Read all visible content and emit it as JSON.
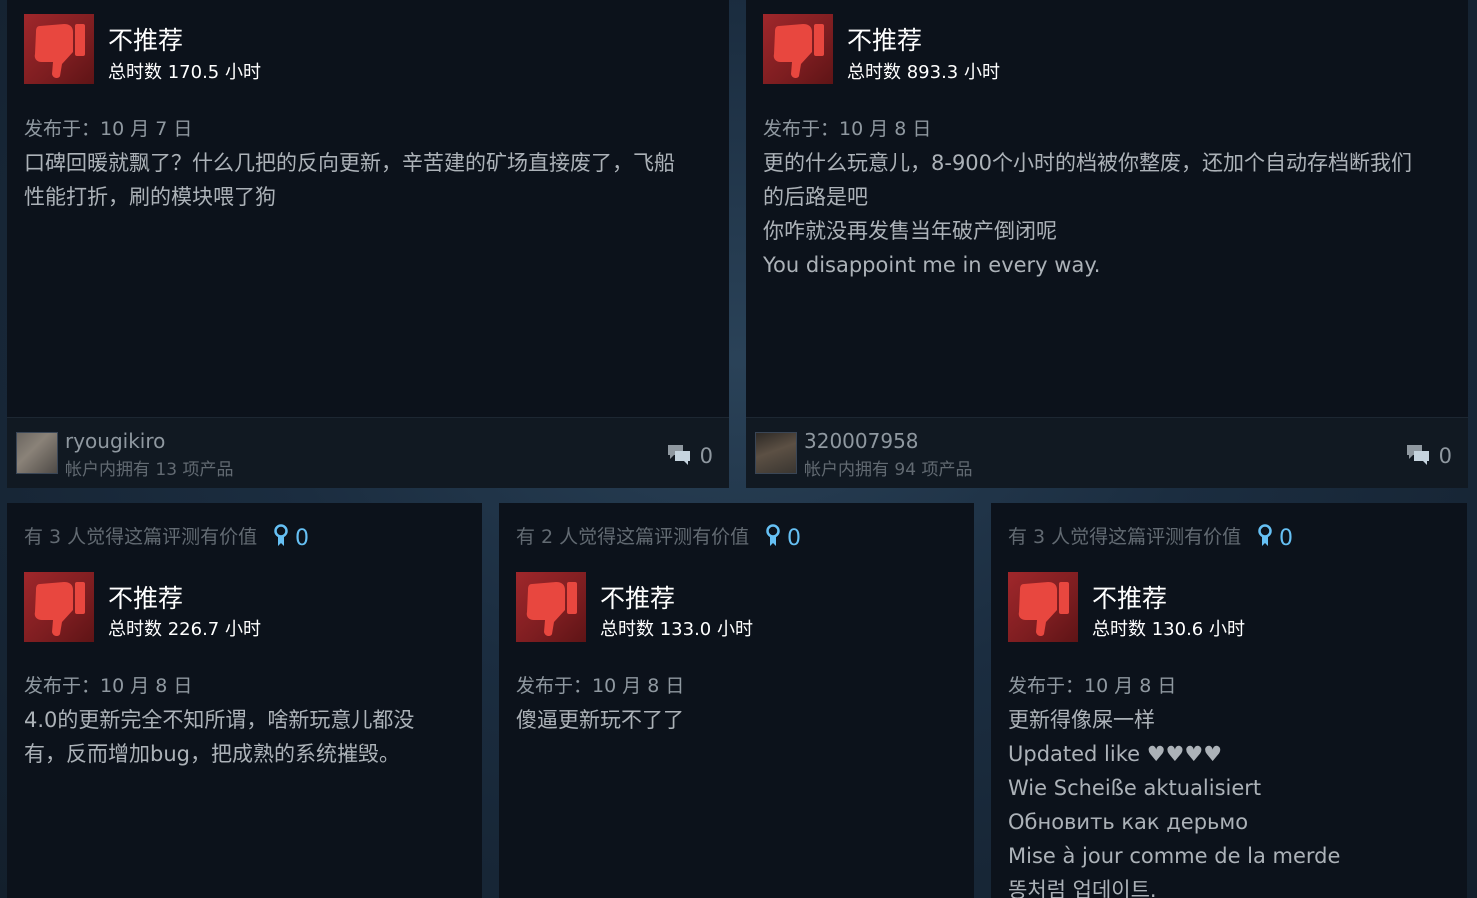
{
  "reviews": [
    {
      "verdict": "不推荐",
      "hours": "总时数 170.5 小时",
      "posted": "发布于：10 月 7 日",
      "lines": [
        "口碑回暖就飘了？什么几把的反向更新，辛苦建的矿场直接废了，飞船",
        "性能打折，刷的模块喂了狗"
      ],
      "author": "ryougikiro",
      "owned": "帐户内拥有 13 项产品",
      "comments": "0"
    },
    {
      "verdict": "不推荐",
      "hours": "总时数 893.3 小时",
      "posted": "发布于：10 月 8 日",
      "lines": [
        "更的什么玩意儿，8-900个小时的档被你整废，还加个自动存档断我们",
        "的后路是吧",
        "你咋就没再发售当年破产倒闭呢",
        "You disappoint me in every way."
      ],
      "author": "320007958",
      "owned": "帐户内拥有 94 项产品",
      "comments": "0"
    },
    {
      "helpful": "有 3 人觉得这篇评测有价值",
      "awards": "0",
      "verdict": "不推荐",
      "hours": "总时数 226.7 小时",
      "posted": "发布于：10 月 8 日",
      "lines": [
        "4.0的更新完全不知所谓，啥新玩意儿都没",
        "有，反而增加bug，把成熟的系统摧毁。"
      ]
    },
    {
      "helpful": "有 2 人觉得这篇评测有价值",
      "awards": "0",
      "verdict": "不推荐",
      "hours": "总时数 133.0 小时",
      "posted": "发布于：10 月 8 日",
      "lines": [
        "傻逼更新玩不了了"
      ]
    },
    {
      "helpful": "有 3 人觉得这篇评测有价值",
      "awards": "0",
      "verdict": "不推荐",
      "hours": "总时数 130.6 小时",
      "posted": "发布于：10 月 8 日",
      "lines": [
        "更新得像屎一样",
        "Updated like ♥♥♥♥",
        "Wie Scheiße aktualisiert",
        "Обновить как дерьмо",
        "Mise à jour comme de la merde",
        "똥처럼 업데이트."
      ]
    }
  ],
  "colors": {
    "negative": "#a0272b",
    "accent": "#66c0f4",
    "card_bg": "#0c121b"
  },
  "icons": {
    "thumb": "thumbs-down-icon",
    "comment": "comment-icon",
    "award": "award-icon"
  }
}
